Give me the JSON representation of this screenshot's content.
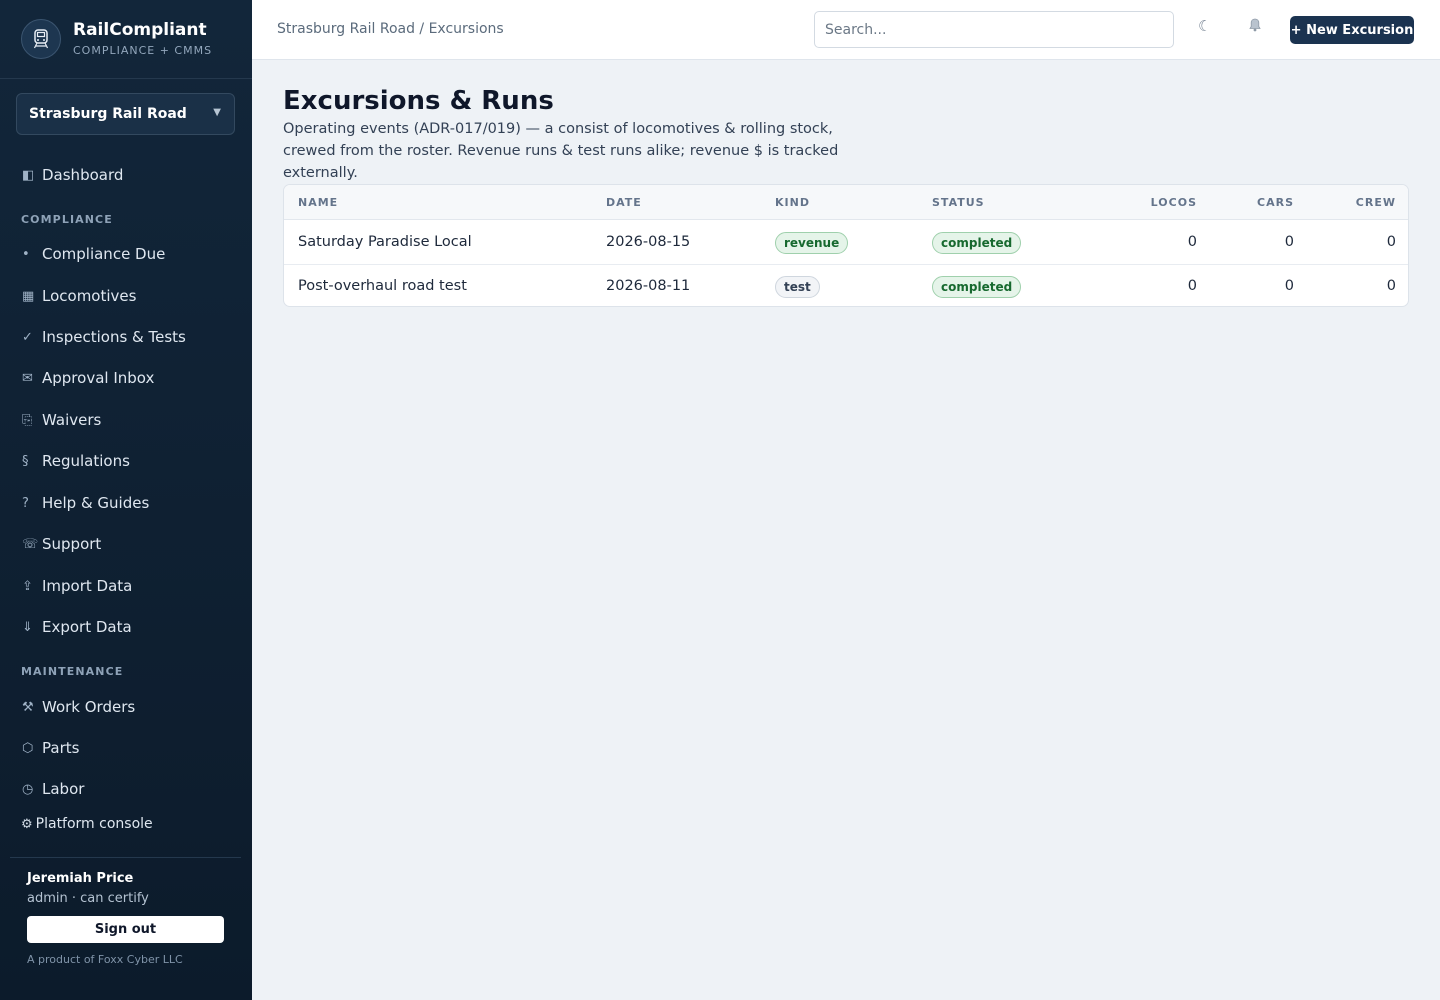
{
  "brand": {
    "name": "RailCompliant",
    "subtitle": "COMPLIANCE + CMMS"
  },
  "org_selector": {
    "value": "Strasburg Rail Road"
  },
  "sidebar": {
    "top_items": [
      {
        "icon": "dashboard-icon",
        "label": "Dashboard"
      }
    ],
    "compliance_heading": "COMPLIANCE",
    "compliance_items": [
      {
        "icon": "dot-icon",
        "label": "Compliance Due"
      },
      {
        "icon": "grid-icon",
        "label": "Locomotives"
      },
      {
        "icon": "check-icon",
        "label": "Inspections & Tests"
      },
      {
        "icon": "envelope-icon",
        "label": "Approval Inbox"
      },
      {
        "icon": "document-icon",
        "label": "Waivers"
      },
      {
        "icon": "section-icon",
        "label": "Regulations"
      },
      {
        "icon": "question-icon",
        "label": "Help & Guides"
      },
      {
        "icon": "phone-icon",
        "label": "Support"
      },
      {
        "icon": "import-icon",
        "label": "Import Data"
      },
      {
        "icon": "export-icon",
        "label": "Export Data"
      }
    ],
    "maintenance_heading": "MAINTENANCE",
    "maintenance_items": [
      {
        "icon": "tools-icon",
        "label": "Work Orders"
      },
      {
        "icon": "hexagon-icon",
        "label": "Parts"
      },
      {
        "icon": "clock-icon",
        "label": "Labor"
      }
    ],
    "platform_console": "Platform console"
  },
  "user": {
    "name": "Jeremiah Price",
    "role": "admin · can certify",
    "sign_out": "Sign out",
    "credit": "A product of Foxx Cyber LLC"
  },
  "topbar": {
    "breadcrumb": "Strasburg Rail Road / Excursions",
    "search_placeholder": "Search...",
    "new_button": "+ New Excursion"
  },
  "page": {
    "title": "Excursions & Runs",
    "description": "Operating events (ADR-017/019) — a consist of locomotives & rolling stock, crewed from the roster. Revenue runs & test runs alike; revenue $ is tracked externally."
  },
  "table": {
    "columns": [
      "NAME",
      "DATE",
      "KIND",
      "STATUS",
      "LOCOS",
      "CARS",
      "CREW"
    ],
    "rows": [
      {
        "name": "Saturday Paradise Local",
        "date": "2026-08-15",
        "kind": "revenue",
        "status": "completed",
        "locos": "0",
        "cars": "0",
        "crew": "0"
      },
      {
        "name": "Post-overhaul road test",
        "date": "2026-08-11",
        "kind": "test",
        "status": "completed",
        "locos": "0",
        "cars": "0",
        "crew": "0"
      }
    ]
  },
  "colors": {
    "sidebar_bg": "#12263a",
    "primary_button": "#1b3350",
    "badge_green": "#17692f"
  }
}
